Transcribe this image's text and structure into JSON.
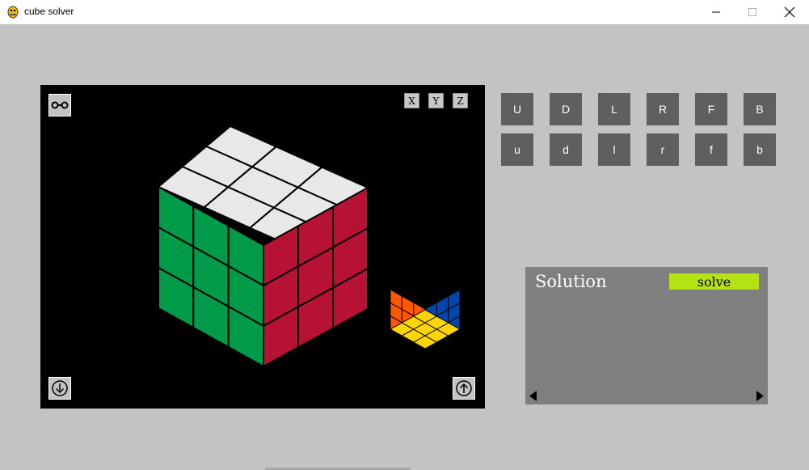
{
  "window": {
    "title": "cube solver",
    "controls": [
      "minimize",
      "maximize",
      "close"
    ]
  },
  "viewport": {
    "axis_buttons": [
      "X",
      "Y",
      "Z"
    ],
    "icons": {
      "top_left": "link-icon",
      "bottom_left": "arrow-down-circle-icon",
      "bottom_right": "arrow-up-circle-icon"
    },
    "cube_colors": {
      "top": "#e8e8e8",
      "left": "#009b48",
      "right": "#b71234",
      "mini_left": "#ff5800",
      "mini_right": "#0046ad",
      "mini_bottom": "#ffd500"
    }
  },
  "moves": {
    "row1": [
      "U",
      "D",
      "L",
      "R",
      "F",
      "B"
    ],
    "row2": [
      "u",
      "d",
      "l",
      "r",
      "f",
      "b"
    ]
  },
  "solution": {
    "title": "Solution",
    "solve_label": "solve",
    "solve_color": "#b4e214"
  }
}
